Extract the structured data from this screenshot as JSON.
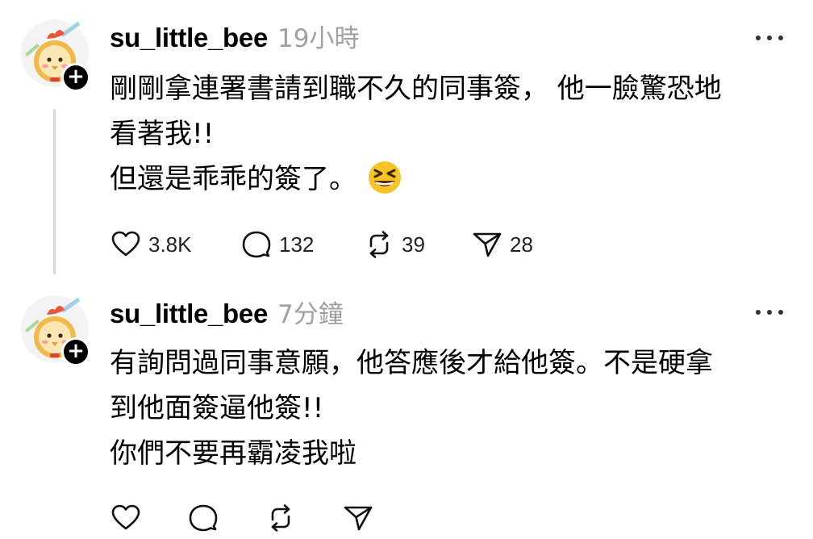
{
  "posts": [
    {
      "username": "su_little_bee",
      "timestamp": "19小時",
      "lines": [
        "剛剛拿連署書請到職不久的同事簽， 他一臉驚恐地",
        "看著我!!",
        "但還是乖乖的簽了。"
      ],
      "emoji": "grinning-squinting-face",
      "likes": "3.8K",
      "replies": "132",
      "reposts": "39",
      "shares": "28"
    },
    {
      "username": "su_little_bee",
      "timestamp": "7分鐘",
      "lines": [
        "有詢問過同事意願，他答應後才給他簽。不是硬拿",
        "到他面簽逼他簽!!",
        "你們不要再霸凌我啦"
      ]
    }
  ],
  "icons": {
    "avatar": "cartoon-chick-avatar",
    "follow": "plus-icon",
    "more": "more-dots-icon",
    "like": "heart-icon",
    "reply": "comment-bubble-icon",
    "repost": "repost-arrows-icon",
    "share": "send-paper-plane-icon"
  },
  "colors": {
    "text": "#000000",
    "muted": "#a0a0a0",
    "thread_line": "#d9d9d9"
  }
}
